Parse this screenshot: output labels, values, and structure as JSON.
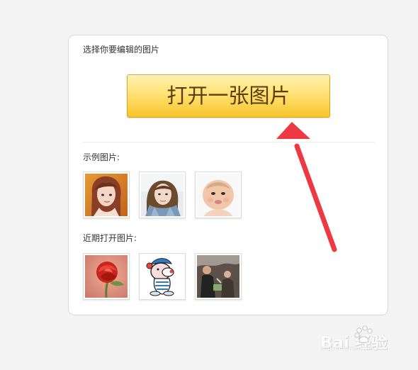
{
  "dialog": {
    "title": "选择你要编辑的图片",
    "open_button": "打开一张图片",
    "sample_label": "示例图片:",
    "recent_label": "近期打开图片:"
  },
  "sample_images": [
    {
      "name": "woman-portrait"
    },
    {
      "name": "girl-selfie"
    },
    {
      "name": "baby-photo"
    }
  ],
  "recent_images": [
    {
      "name": "red-rose"
    },
    {
      "name": "cartoon-bear"
    },
    {
      "name": "people-outdoor"
    }
  ],
  "watermark": {
    "brand": "Bai 经验",
    "url": "jingyan.baidu.com"
  },
  "colors": {
    "button_gradient_top": "#fff1ae",
    "button_gradient_bottom": "#f7c52b",
    "button_text": "#5e3d08",
    "arrow": "#ee3b44"
  }
}
